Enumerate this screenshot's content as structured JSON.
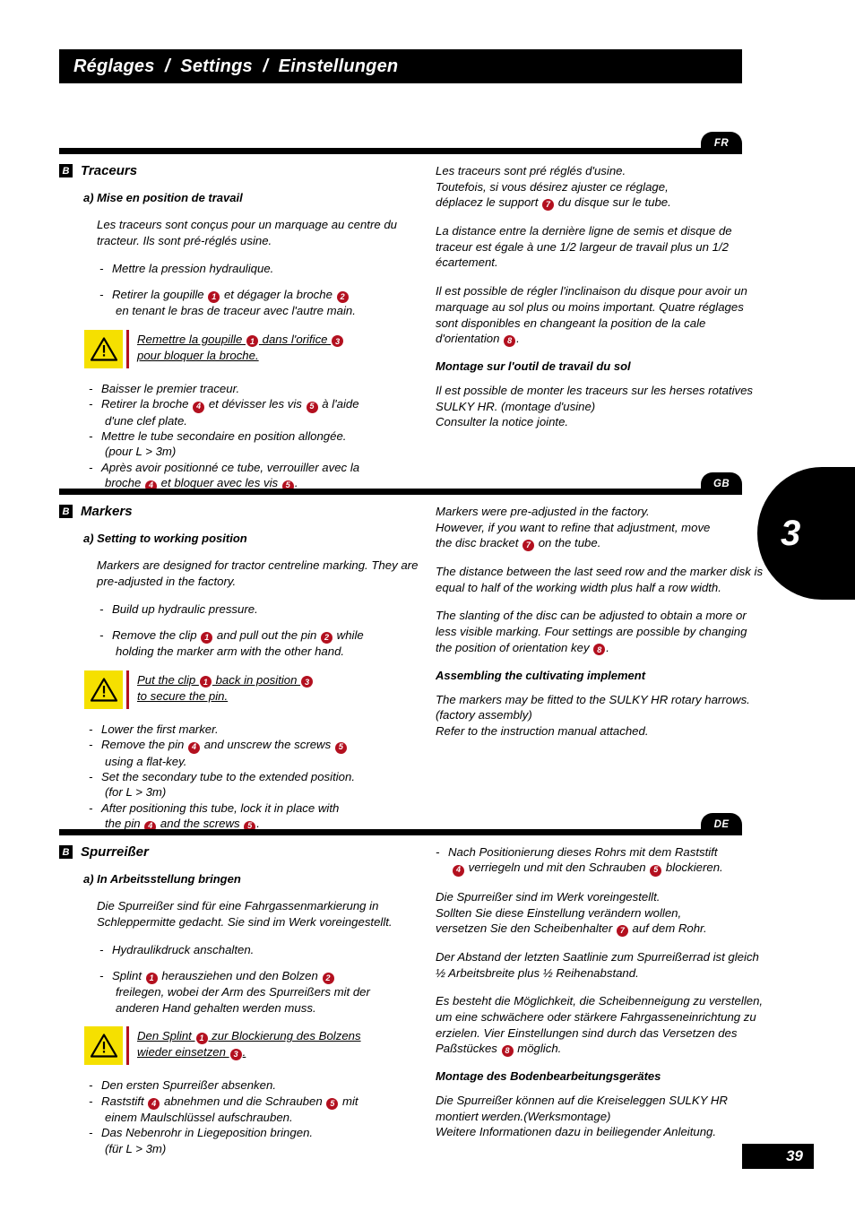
{
  "header": {
    "title": "Réglages  /  Settings  /  Einstellungen"
  },
  "chapter_tab": {
    "number": "3"
  },
  "footer": {
    "page_number": "39"
  },
  "sections": [
    {
      "lang_badge": "FR",
      "letter": "B",
      "title": "Traceurs",
      "subtitle": "a) Mise en position de travail",
      "intro": "Les traceurs sont conçus pour un marquage au centre du tracteur. Ils sont pré-réglés usine.",
      "bullets_before": [
        {
          "prefix": "Mettre la pression hydraulique.",
          "nums": [],
          "lines": []
        },
        {
          "prefix": "Retirer la goupille ",
          "n1": "1",
          "mid": " et dégager la broche ",
          "n2": "2",
          "line2": "en tenant le bras de traceur avec l'autre main."
        }
      ],
      "warning": {
        "line1_a": "Remettre la goupille ",
        "line1_n1": "1",
        "line1_b": " dans l'orifice ",
        "line1_n2": "3",
        "line2": "pour bloquer la broche."
      },
      "bullets_after": [
        {
          "text": "Baisser le premier traceur."
        },
        {
          "a": "Retirer la broche ",
          "n1": "4",
          "b": " et dévisser les vis ",
          "n2": "5",
          "c": " à l'aide",
          "cont": "d'une clef plate."
        },
        {
          "text": "Mettre le tube secondaire en position allongée.",
          "cont": "(pour L > 3m)"
        },
        {
          "a": "Après avoir positionné ce tube, verrouiller avec la",
          "cont_a": "broche ",
          "n1": "4",
          "cont_b": " et bloquer avec les vis ",
          "n2": "5",
          "cont_c": "."
        }
      ],
      "right_paras": [
        "Les traceurs sont pré réglés d'usine.\nToutefois, si vous désirez ajuster ce réglage,",
        "La distance entre la dernière ligne de semis et disque de traceur est égale à une 1/2 largeur de travail plus un 1/2 écartement."
      ],
      "right_p1_a": "Les traceurs sont pré réglés d'usine.",
      "right_p1_b": "Toutefois, si vous désirez ajuster ce réglage,",
      "right_p1_c": "déplacez le support ",
      "right_p1_n": "7",
      "right_p1_d": " du disque sur le tube.",
      "right_p2": "La distance entre la dernière ligne de semis et disque de traceur est égale à une 1/2 largeur de travail plus un 1/2 écartement.",
      "right_p3_a": "Il est possible de régler l'inclinaison du disque pour avoir un marquage au sol plus ou moins important. Quatre réglages sont disponibles en changeant la position de la cale d'orientation ",
      "right_p3_n": "8",
      "right_p3_b": ".",
      "right_head": "Montage sur l'outil de travail du sol",
      "right_p4": "Il est possible de monter les traceurs sur les herses rotatives SULKY HR. (montage d'usine)\nConsulter la notice jointe.",
      "right_p4_a": "Il est possible de monter les traceurs sur les herses rotatives SULKY HR. (montage d'usine)",
      "right_p4_b": "Consulter la notice jointe."
    },
    {
      "lang_badge": "GB",
      "letter": "B",
      "title": "Markers",
      "subtitle": "a) Setting to working position",
      "intro": "Markers are designed for tractor centreline marking. They are pre-adjusted in the factory.",
      "b1": "Build up hydraulic pressure.",
      "b2_a": "Remove the clip ",
      "b2_n1": "1",
      "b2_b": " and pull out the pin ",
      "b2_n2": "2",
      "b2_c": " while",
      "b2_cont": "holding the marker arm with the other hand.",
      "warning": {
        "line1_a": "Put the clip ",
        "line1_n1": "1",
        "line1_b": " back in position ",
        "line1_n2": "3",
        "line2": "to secure the pin."
      },
      "a1": "Lower the first marker.",
      "a2_a": "Remove the pin ",
      "a2_n1": "4",
      "a2_b": " and unscrew the screws ",
      "a2_n2": "5",
      "a2_cont": "using a flat-key.",
      "a3": "Set the secondary tube to the extended position.",
      "a3_cont": "(for L > 3m)",
      "a4": "After positioning this tube, lock it in place with",
      "a4_cont_a": "the pin ",
      "a4_n1": "4",
      "a4_cont_b": " and the screws ",
      "a4_n2": "5",
      "a4_cont_c": ".",
      "right_p1_a": "Markers were pre-adjusted in the factory.",
      "right_p1_b": "However, if you want to refine that adjustment, move",
      "right_p1_c": "the disc bracket  ",
      "right_p1_n": "7",
      "right_p1_d": " on the tube.",
      "right_p2": "The distance between the last seed row and the marker disk is equal to half of the working width plus half a row width.",
      "right_p3_a": "The slanting of the disc can be adjusted to obtain a more or less visible marking. Four settings are possible by changing the position of orientation key ",
      "right_p3_n": "8",
      "right_p3_b": ".",
      "right_head": "Assembling the cultivating implement",
      "right_p4_a": "The markers may be fitted to the SULKY HR rotary harrows.(factory assembly)",
      "right_p4_b": "Refer to the instruction manual attached."
    },
    {
      "lang_badge": "DE",
      "letter": "B",
      "title": "Spurreißer",
      "subtitle": "a) In Arbeitsstellung bringen",
      "intro": "Die Spurreißer sind für eine Fahrgassenmarkierung in Schleppermitte gedacht. Sie sind im Werk voreingestellt.",
      "b1": "Hydraulikdruck anschalten.",
      "b2_a": "Splint ",
      "b2_n1": "1",
      "b2_b": " herausziehen und den Bolzen ",
      "b2_n2": "2",
      "b2_cont1": "freilegen, wobei der Arm des Spurreißers mit der",
      "b2_cont2": "anderen Hand gehalten werden muss.",
      "warning": {
        "line1_a": "Den Splint ",
        "line1_n1": "1",
        "line1_b": " zur Blockierung des Bolzens",
        "line2_a": "wieder einsetzen ",
        "line2_n2": "3",
        "line2_b": "."
      },
      "a1": "Den ersten Spurreißer absenken.",
      "a2_a": "Raststift ",
      "a2_n1": "4",
      "a2_b": " abnehmen und die Schrauben ",
      "a2_n2": "5",
      "a2_c": " mit",
      "a2_cont": "einem Maulschlüssel aufschrauben.",
      "a3": "Das Nebenrohr in Liegeposition bringen.",
      "a3_cont": "(für L > 3m)",
      "right_b1_a": "Nach Positionierung dieses Rohrs mit dem Raststift",
      "right_b1_n1": "4",
      "right_b1_b": " verriegeln und mit den Schrauben ",
      "right_b1_n2": "5",
      "right_b1_c": " blockieren.",
      "right_p1_a": "Die Spurreißer sind im Werk voreingestellt.",
      "right_p1_b": "Sollten Sie diese Einstellung verändern wollen,",
      "right_p1_c": "versetzen Sie den Scheibenhalter  ",
      "right_p1_n": "7",
      "right_p1_d": " auf dem Rohr.",
      "right_p2": "Der Abstand der letzten Saatlinie zum Spurreißerrad ist gleich ½ Arbeitsbreite plus ½ Reihenabstand.",
      "right_p3_a": "Es besteht die Möglichkeit, die Scheibenneigung zu verstellen, um eine schwächere oder stärkere Fahrgasseneinrichtung zu erzielen. Vier Einstellungen sind durch das Versetzen des Paßstückes ",
      "right_p3_n": "8",
      "right_p3_b": " möglich.",
      "right_head": "Montage des Bodenbearbeitungsgerätes",
      "right_p4_a": "Die Spurreißer können auf die Kreiseleggen SULKY HR montiert werden.(Werksmontage)",
      "right_p4_b": "Weitere Informationen dazu in beiliegender Anleitung."
    }
  ]
}
